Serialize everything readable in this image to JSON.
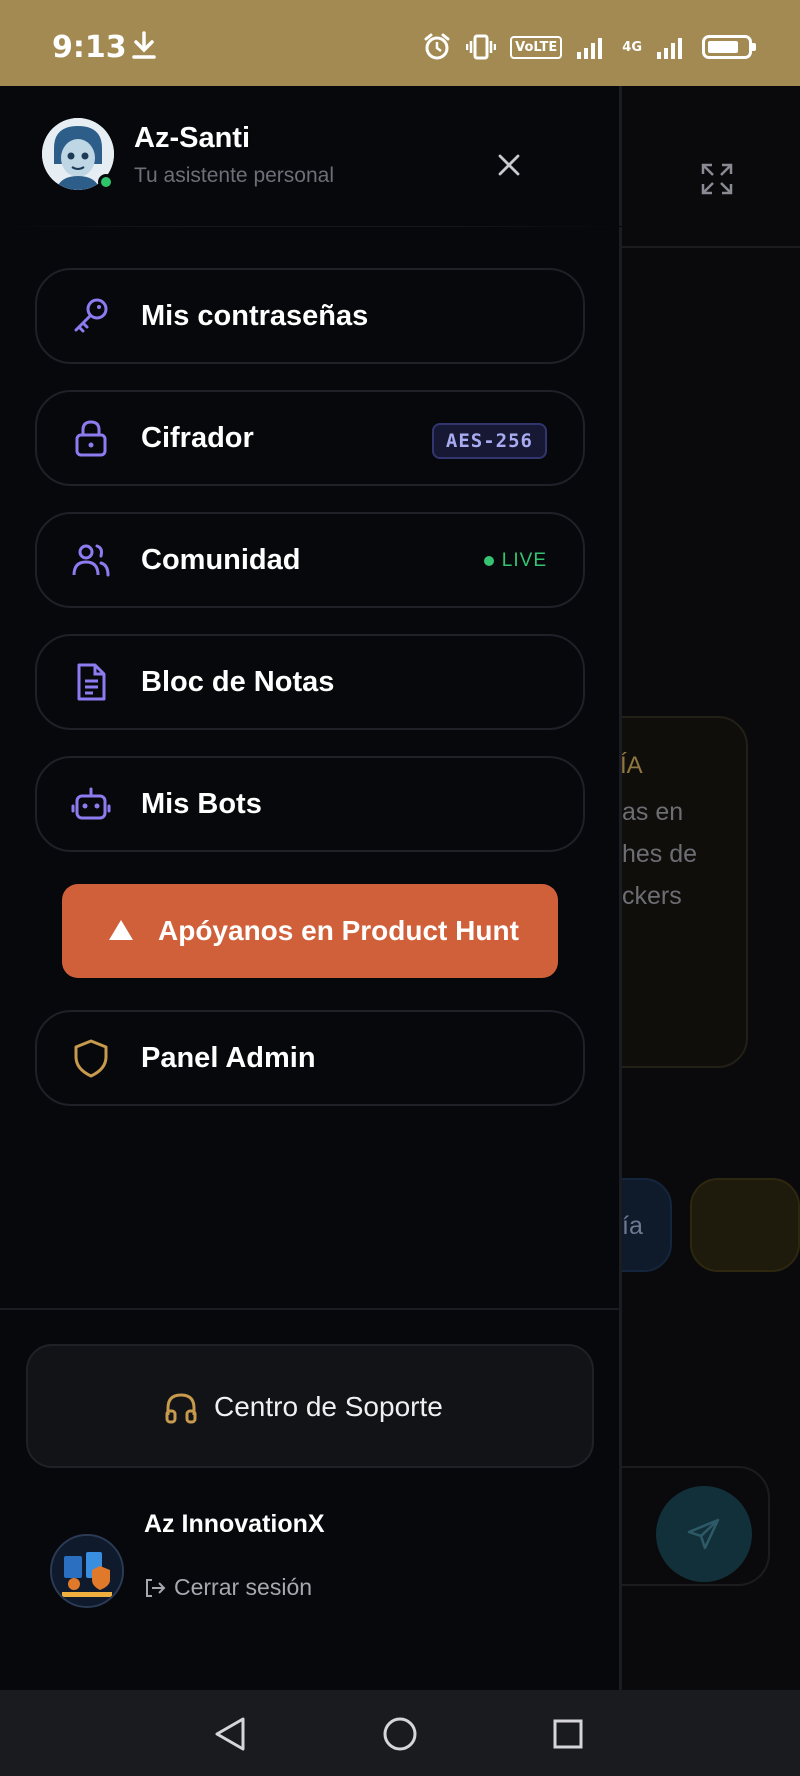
{
  "status_bar": {
    "time": "9:13",
    "volte_label": "VoLTE",
    "network_label": "4G",
    "battery_level": 0.8
  },
  "drawer": {
    "app_name": "Az-Santi",
    "app_subtitle": "Tu asistente personal",
    "menu": [
      {
        "label": "Mis contraseñas",
        "icon": "key-icon"
      },
      {
        "label": "Cifrador",
        "icon": "lock-icon",
        "badge": "AES-256"
      },
      {
        "label": "Comunidad",
        "icon": "users-icon",
        "badge": "LIVE"
      },
      {
        "label": "Bloc de Notas",
        "icon": "document-icon"
      },
      {
        "label": "Mis Bots",
        "icon": "bot-icon"
      }
    ],
    "product_hunt_label": "Apóyanos en Product Hunt",
    "admin_label": "Panel Admin",
    "support_label": "Centro de Soporte",
    "org_name": "Az InnovationX",
    "logout_label": "Cerrar sesión"
  },
  "background": {
    "card_title": "ÍA",
    "card_lines": [
      "as en",
      "hes de",
      "ckers"
    ],
    "pill_text": "ía"
  },
  "colors": {
    "accent_purple": "#8b7cf0",
    "accent_gold": "#c79a4e",
    "product_hunt": "#d0603a",
    "live_green": "#35c372"
  }
}
